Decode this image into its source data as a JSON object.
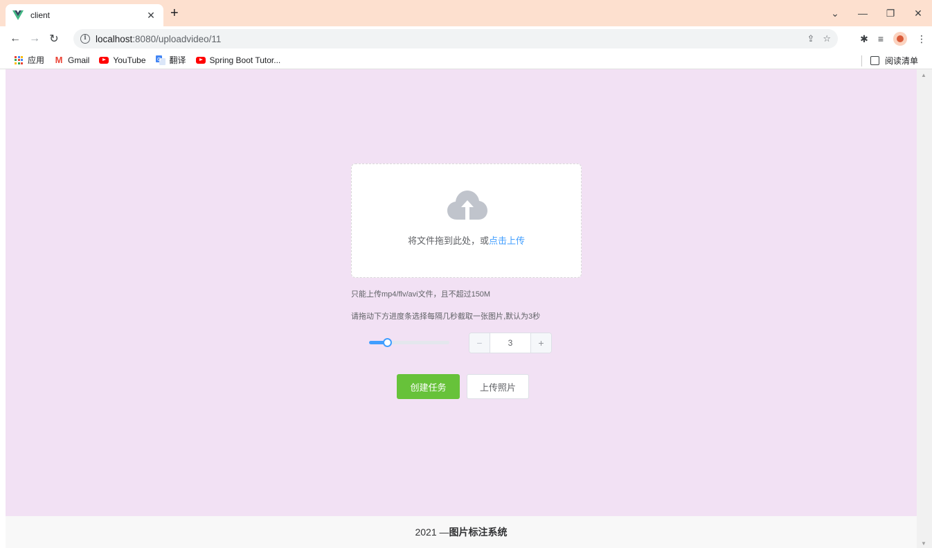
{
  "browser": {
    "tab_title": "client",
    "url_host": "localhost",
    "url_path": ":8080/uploadvideo/11",
    "bookmarks": [
      {
        "label": "应用",
        "icon": "apps-icon"
      },
      {
        "label": "Gmail",
        "icon": "gmail-icon"
      },
      {
        "label": "YouTube",
        "icon": "youtube-icon"
      },
      {
        "label": "翻译",
        "icon": "translate-icon"
      },
      {
        "label": "Spring Boot Tutor...",
        "icon": "youtube-icon"
      }
    ],
    "reading_list": "阅读清单"
  },
  "upload": {
    "drag_text": "将文件拖到此处，或",
    "click_text": "点击上传",
    "tip_format": "只能上传mp4/flv/avi文件，且不超过150M",
    "tip_slider": "请拖动下方进度条选择每隔几秒截取一张图片,默认为3秒"
  },
  "interval": {
    "value": "3",
    "slider_fraction": 0.22,
    "minus": "−",
    "plus": "+"
  },
  "buttons": {
    "create": "创建任务",
    "upload_photo": "上传照片"
  },
  "footer": {
    "year": "2021 — ",
    "title": "图片标注系统"
  },
  "colors": {
    "page_bg": "#f2e1f4",
    "primary": "#409eff",
    "success": "#67c23a",
    "tab_strip": "#fde0cf"
  }
}
